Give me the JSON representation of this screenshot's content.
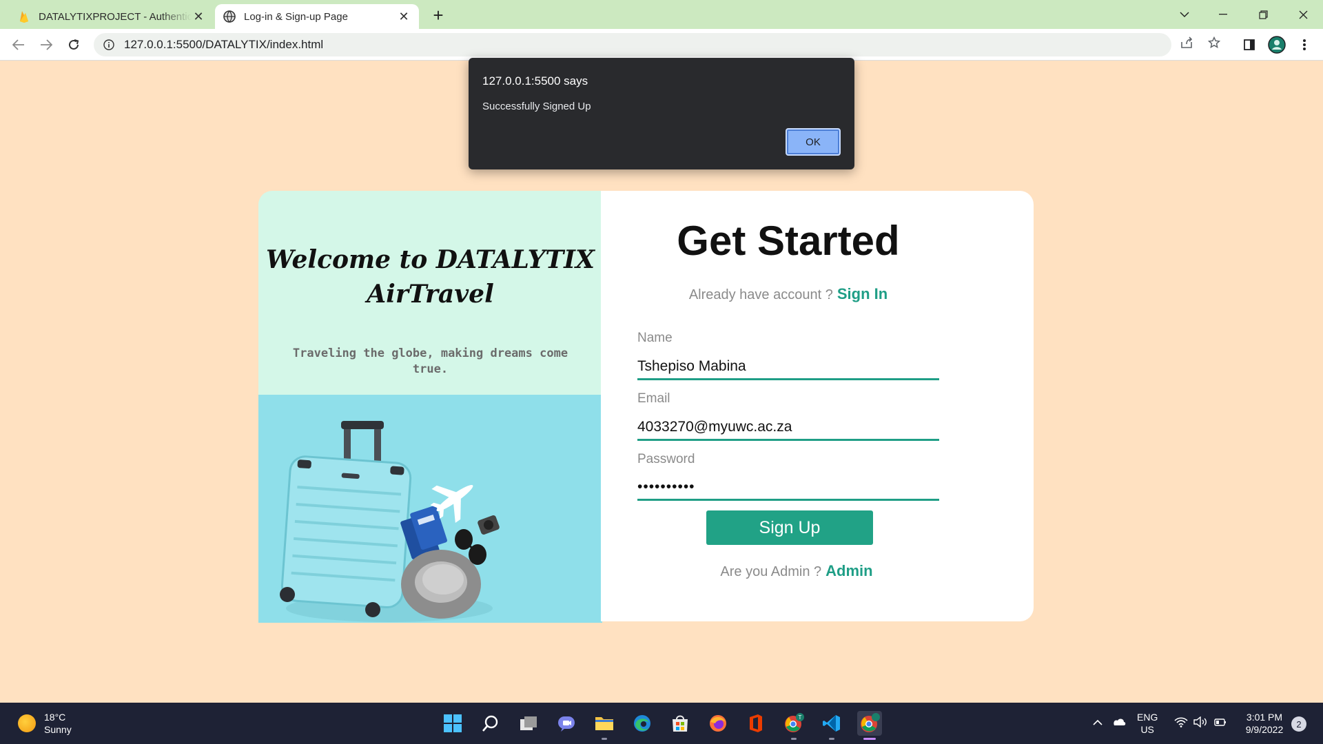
{
  "browser": {
    "tabs": [
      {
        "title": "DATALYTIXPROJECT - Authentication",
        "active": false,
        "icon": "firebase-icon"
      },
      {
        "title": "Log-in & Sign-up Page",
        "active": true,
        "icon": "globe-icon"
      }
    ],
    "url": "127.0.0.1:5500/DATALYTIX/index.html"
  },
  "alert": {
    "origin": "127.0.0.1:5500 says",
    "message": "Successfully Signed Up",
    "ok_label": "OK"
  },
  "left_panel": {
    "welcome_line1": "Welcome to DATALYTIX",
    "welcome_line2": "AirTravel",
    "tagline": "Traveling the globe, making dreams come true."
  },
  "form": {
    "heading": "Get Started",
    "account_prompt": "Already have account ?",
    "signin_link": "Sign In",
    "name_label": "Name",
    "name_value": "Tshepiso Mabina",
    "email_label": "Email",
    "email_value": "4033270@myuwc.ac.za",
    "password_label": "Password",
    "password_value": "••••••••••",
    "submit_label": "Sign Up",
    "admin_prompt": "Are you Admin ?",
    "admin_link": "Admin"
  },
  "taskbar": {
    "temperature": "18°C",
    "weather": "Sunny",
    "language_line1": "ENG",
    "language_line2": "US",
    "time": "3:01 PM",
    "date": "9/9/2022",
    "notification_count": "2"
  },
  "colors": {
    "page_background": "#ffe1c1",
    "accent_green": "#1f9e86",
    "left_panel_mint": "#d4f7e8",
    "photo_cyan": "#8fdfea"
  }
}
